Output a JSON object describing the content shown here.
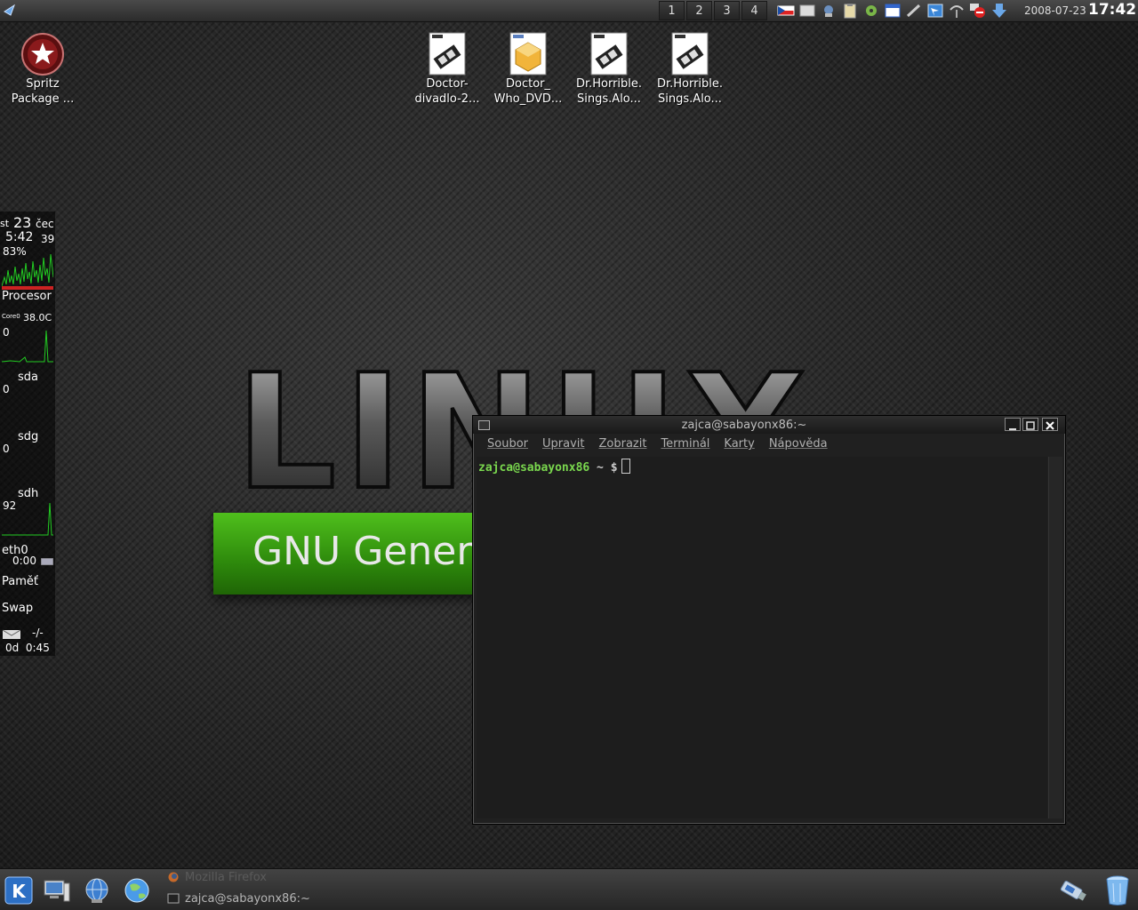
{
  "top_panel": {
    "pager": [
      "1",
      "2",
      "3",
      "4"
    ],
    "date": "2008-07-23",
    "time": "17:42",
    "tray_icons": [
      "keyboard-layout-icon",
      "display-icon",
      "network-icon",
      "clipboard-icon",
      "settings-icon",
      "calendar-icon",
      "tool-icon",
      "window-icon",
      "wifi-icon",
      "block-icon",
      "download-icon"
    ]
  },
  "desktop_icons": [
    {
      "line1": "Spritz",
      "line2": "Package ...",
      "icon": "star-badge-icon"
    },
    {
      "line1": "Doctor-",
      "line2": "divadlo-2...",
      "icon": "video-file-icon"
    },
    {
      "line1": "Doctor_",
      "line2": "Who_DVD...",
      "icon": "package-file-icon"
    },
    {
      "line1": "Dr.Horrible.",
      "line2": "Sings.Alo...",
      "icon": "video-file-icon"
    },
    {
      "line1": "Dr.Horrible.",
      "line2": "Sings.Alo...",
      "icon": "video-file-icon"
    }
  ],
  "wallpaper": {
    "logo_text": "LINUX",
    "banner_text": "GNU Genera"
  },
  "sysmon": {
    "day": "st",
    "day_num": "23",
    "month": "čec",
    "time": "5:42",
    "seconds": "39",
    "cpu_percent": "83%",
    "cpu_label": "Procesor",
    "core_label": "Core0",
    "temp": "38.0C",
    "cpu_graph_value": "0",
    "sda_label": "sda",
    "sda_value": "0",
    "sdg_label": "sdg",
    "sdg_value": "0",
    "sdh_label": "sdh",
    "sdh_value": "92",
    "net_label": "eth0",
    "net_value": "0:00",
    "mem_label": "Paměť",
    "swap_label": "Swap",
    "mail_value": "-/-",
    "uptime": "0d  0:45",
    "colors": {
      "graph": "#22cc22",
      "alert": "#cc2222"
    }
  },
  "terminal": {
    "title": "zajca@sabayonx86:~",
    "menu": [
      "Soubor",
      "Upravit",
      "Zobrazit",
      "Terminál",
      "Karty",
      "Nápověda"
    ],
    "prompt_user": "zajca@sabayonx86",
    "prompt_rest": " ~ $"
  },
  "taskbar": {
    "launchers": [
      "kde-menu-icon",
      "desktop-computer-icon",
      "konqueror-globe-icon",
      "internet-globe-icon"
    ],
    "tasks": [
      {
        "label": "Mozilla Firefox",
        "icon": "firefox-icon",
        "active": false
      },
      {
        "label": "zajca@sabayonx86:~",
        "icon": "terminal-icon",
        "active": true
      }
    ],
    "right_icons": [
      "usb-drive-icon",
      "trash-icon"
    ]
  }
}
